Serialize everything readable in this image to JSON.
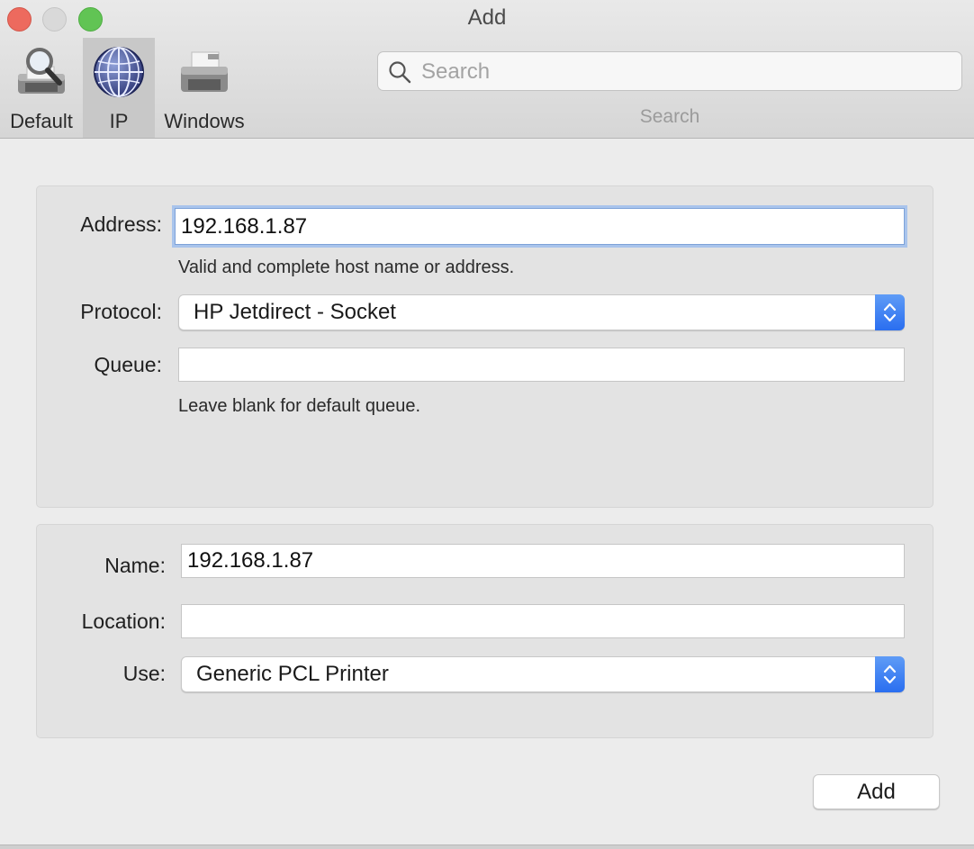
{
  "window": {
    "title": "Add"
  },
  "toolbar": {
    "items": [
      {
        "label": "Default",
        "icon": "printer-magnifier-icon",
        "active": false
      },
      {
        "label": "IP",
        "icon": "globe-icon",
        "active": true
      },
      {
        "label": "Windows",
        "icon": "printer-icon",
        "active": false
      }
    ],
    "search": {
      "placeholder": "Search",
      "value": "",
      "caption": "Search"
    }
  },
  "connection": {
    "address_label": "Address:",
    "address_value": "192.168.1.87",
    "address_hint": "Valid and complete host name or address.",
    "protocol_label": "Protocol:",
    "protocol_value": "HP Jetdirect - Socket",
    "queue_label": "Queue:",
    "queue_value": "",
    "queue_hint": "Leave blank for default queue."
  },
  "printer": {
    "name_label": "Name:",
    "name_value": "192.168.1.87",
    "location_label": "Location:",
    "location_value": "",
    "use_label": "Use:",
    "use_value": "Generic PCL Printer"
  },
  "actions": {
    "add_label": "Add"
  },
  "colors": {
    "accent": "#2a6ef0",
    "focus_ring": "#a9c4ec",
    "close": "#ed6a5e",
    "minimize_disabled": "#d9d9d9",
    "zoom": "#61c454"
  }
}
